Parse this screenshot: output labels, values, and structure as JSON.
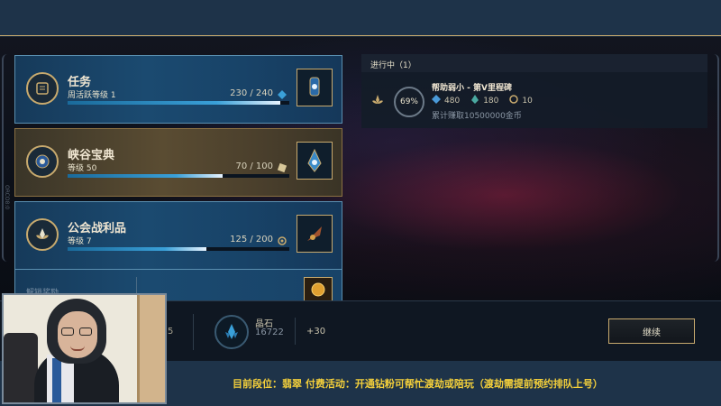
{
  "cards": [
    {
      "title": "任务",
      "subtitle": "周活跃等级 1",
      "count": "230 / 240",
      "progress": 0.958,
      "style": "blue",
      "emblem_icon": "scroll-icon",
      "thumb_icon": "lantern-icon",
      "count_icon": "crystal-icon"
    },
    {
      "title": "峡谷宝典",
      "subtitle": "等级 50",
      "count": "70 / 100",
      "progress": 0.7,
      "style": "gold",
      "emblem_icon": "rune-emblem-icon",
      "thumb_icon": "crystal-tower-icon",
      "count_icon": "ticket-icon"
    },
    {
      "title": "公会战利品",
      "subtitle": "等级 7",
      "count": "125 / 200",
      "progress": 0.625,
      "style": "blue",
      "emblem_icon": "guild-lotus-icon",
      "thumb_icon": "wing-item-icon",
      "count_icon": "guild-token-icon"
    }
  ],
  "partial_card": {
    "label": "解锁奖励"
  },
  "progress_panel": {
    "header": "进行中（1）",
    "percent": "69%",
    "percent_value": 0.69,
    "quest_title": "帮助弱小 - 第V里程碑",
    "rewards": [
      {
        "icon": "blue-essence-icon",
        "value": "480"
      },
      {
        "icon": "green-crystal-icon",
        "value": "180"
      },
      {
        "icon": "guild-token-icon",
        "value": "10"
      }
    ],
    "description": "累计赚取10500000金币"
  },
  "bottom": {
    "left_value": "5",
    "gem_label": "晶石",
    "gem_value": "16722",
    "gem_bonus": "+30",
    "continue_label": "继续"
  },
  "footer": {
    "text": "目前段位：翡翠 付费活动：开通钻粉可帮忙渡劫或陪玩（渡劫需提前预约排队上号）"
  },
  "side_text": "ORCO8:0",
  "colors": {
    "gold": "#c8aa6e",
    "footer_text": "#f3cf3b",
    "bar_blue": "#3aa0d8"
  }
}
